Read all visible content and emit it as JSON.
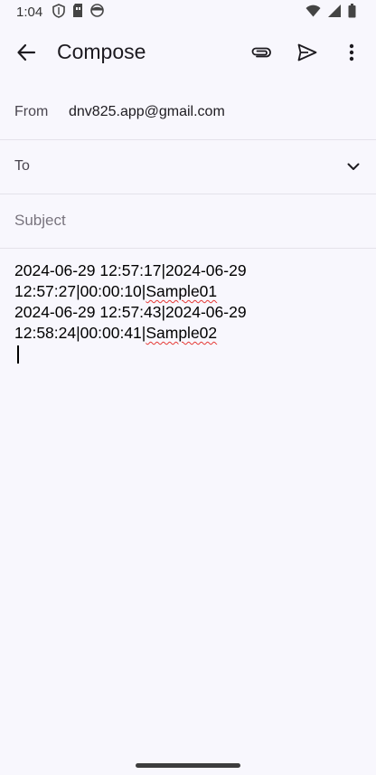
{
  "status_bar": {
    "time": "1:04",
    "left_icons": [
      "shield-icon",
      "sim-card-icon",
      "face-icon"
    ],
    "right_icons": [
      "wifi-icon",
      "signal-icon",
      "battery-icon"
    ]
  },
  "app_bar": {
    "title": "Compose",
    "back_icon": "arrow-back-icon",
    "attach_icon": "paperclip-icon",
    "send_icon": "send-icon",
    "more_icon": "more-vert-icon"
  },
  "form": {
    "from_label": "From",
    "from_value": "dnv825.app@gmail.com",
    "to_label": "To",
    "subject_placeholder": "Subject"
  },
  "body": {
    "entries": [
      {
        "line1": "2024-06-29 12:57:17|2024-06-29",
        "line2_prefix": "12:57:27|00:00:10|",
        "line2_word": "Sample01"
      },
      {
        "line1": "2024-06-29 12:57:43|2024-06-29",
        "line2_prefix": "12:58:24|00:00:41|",
        "line2_word": "Sample02"
      }
    ]
  },
  "colors": {
    "background": "#f8f7fd",
    "text_primary": "#1d1b20",
    "text_secondary": "#49454f",
    "spellcheck": "#e53935"
  }
}
